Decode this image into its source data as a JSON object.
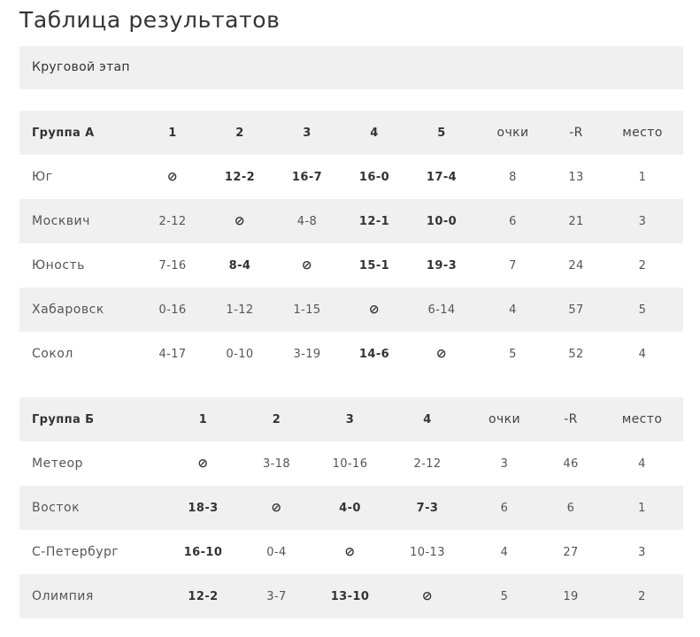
{
  "title": "Таблица результатов",
  "stage": "Круговой этап",
  "group_a": {
    "header": [
      "Группа А",
      "1",
      "2",
      "3",
      "4",
      "5",
      "очки",
      "-R",
      "место"
    ],
    "rows": [
      [
        "Юг",
        "⊘",
        "12-2",
        "16-7",
        "16-0",
        "17-4",
        "8",
        "13",
        "1"
      ],
      [
        "Москвич",
        "2-12",
        "⊘",
        "4-8",
        "12-1",
        "10-0",
        "6",
        "21",
        "3"
      ],
      [
        "Юность",
        "7-16",
        "8-4",
        "⊘",
        "15-1",
        "19-3",
        "7",
        "24",
        "2"
      ],
      [
        "Хабаровск",
        "0-16",
        "1-12",
        "1-15",
        "⊘",
        "6-14",
        "4",
        "57",
        "5"
      ],
      [
        "Сокол",
        "4-17",
        "0-10",
        "3-19",
        "14-6",
        "⊘",
        "5",
        "52",
        "4"
      ]
    ]
  },
  "group_b": {
    "header": [
      "Группа Б",
      "1",
      "2",
      "3",
      "4",
      "очки",
      "-R",
      "место"
    ],
    "rows": [
      [
        "Метеор",
        "⊘",
        "3-18",
        "10-16",
        "2-12",
        "3",
        "46",
        "4"
      ],
      [
        "Восток",
        "18-3",
        "⊘",
        "4-0",
        "7-3",
        "6",
        "6",
        "1"
      ],
      [
        "С-Петербург",
        "16-10",
        "0-4",
        "⊘",
        "10-13",
        "4",
        "27",
        "3"
      ],
      [
        "Олимпия",
        "12-2",
        "3-7",
        "13-10",
        "⊘",
        "5",
        "19",
        "2"
      ]
    ]
  }
}
